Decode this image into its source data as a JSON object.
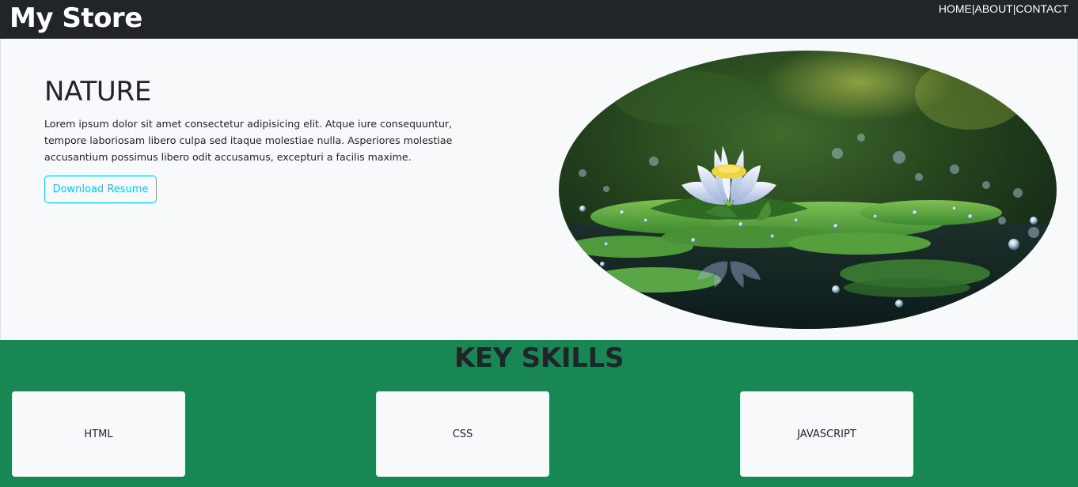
{
  "header": {
    "brand": "My Store",
    "nav": [
      "HOME",
      "ABOUT",
      "CONTACT"
    ],
    "separator": "|"
  },
  "hero": {
    "title": "NATURE",
    "text": "Lorem ipsum dolor sit amet consectetur adipisicing elit. Atque iure consequuntur, tempore laboriosam libero culpa sed itaque molestiae nulla. Asperiores molestiae accusantium possimus libero odit accusamus, excepturi a facilis maxime.",
    "button_label": "Download Resume",
    "image_subject": "water-lily-photo"
  },
  "skills": {
    "title": "KEY SKILLS",
    "items": [
      "HTML",
      "CSS",
      "JAVASCRIPT"
    ]
  },
  "colors": {
    "navbar": "#212529",
    "hero_bg": "#f8f9fa",
    "accent_button": "#0dcaf0",
    "skills_bg": "#198754",
    "card_bg": "#f8f9fa"
  }
}
